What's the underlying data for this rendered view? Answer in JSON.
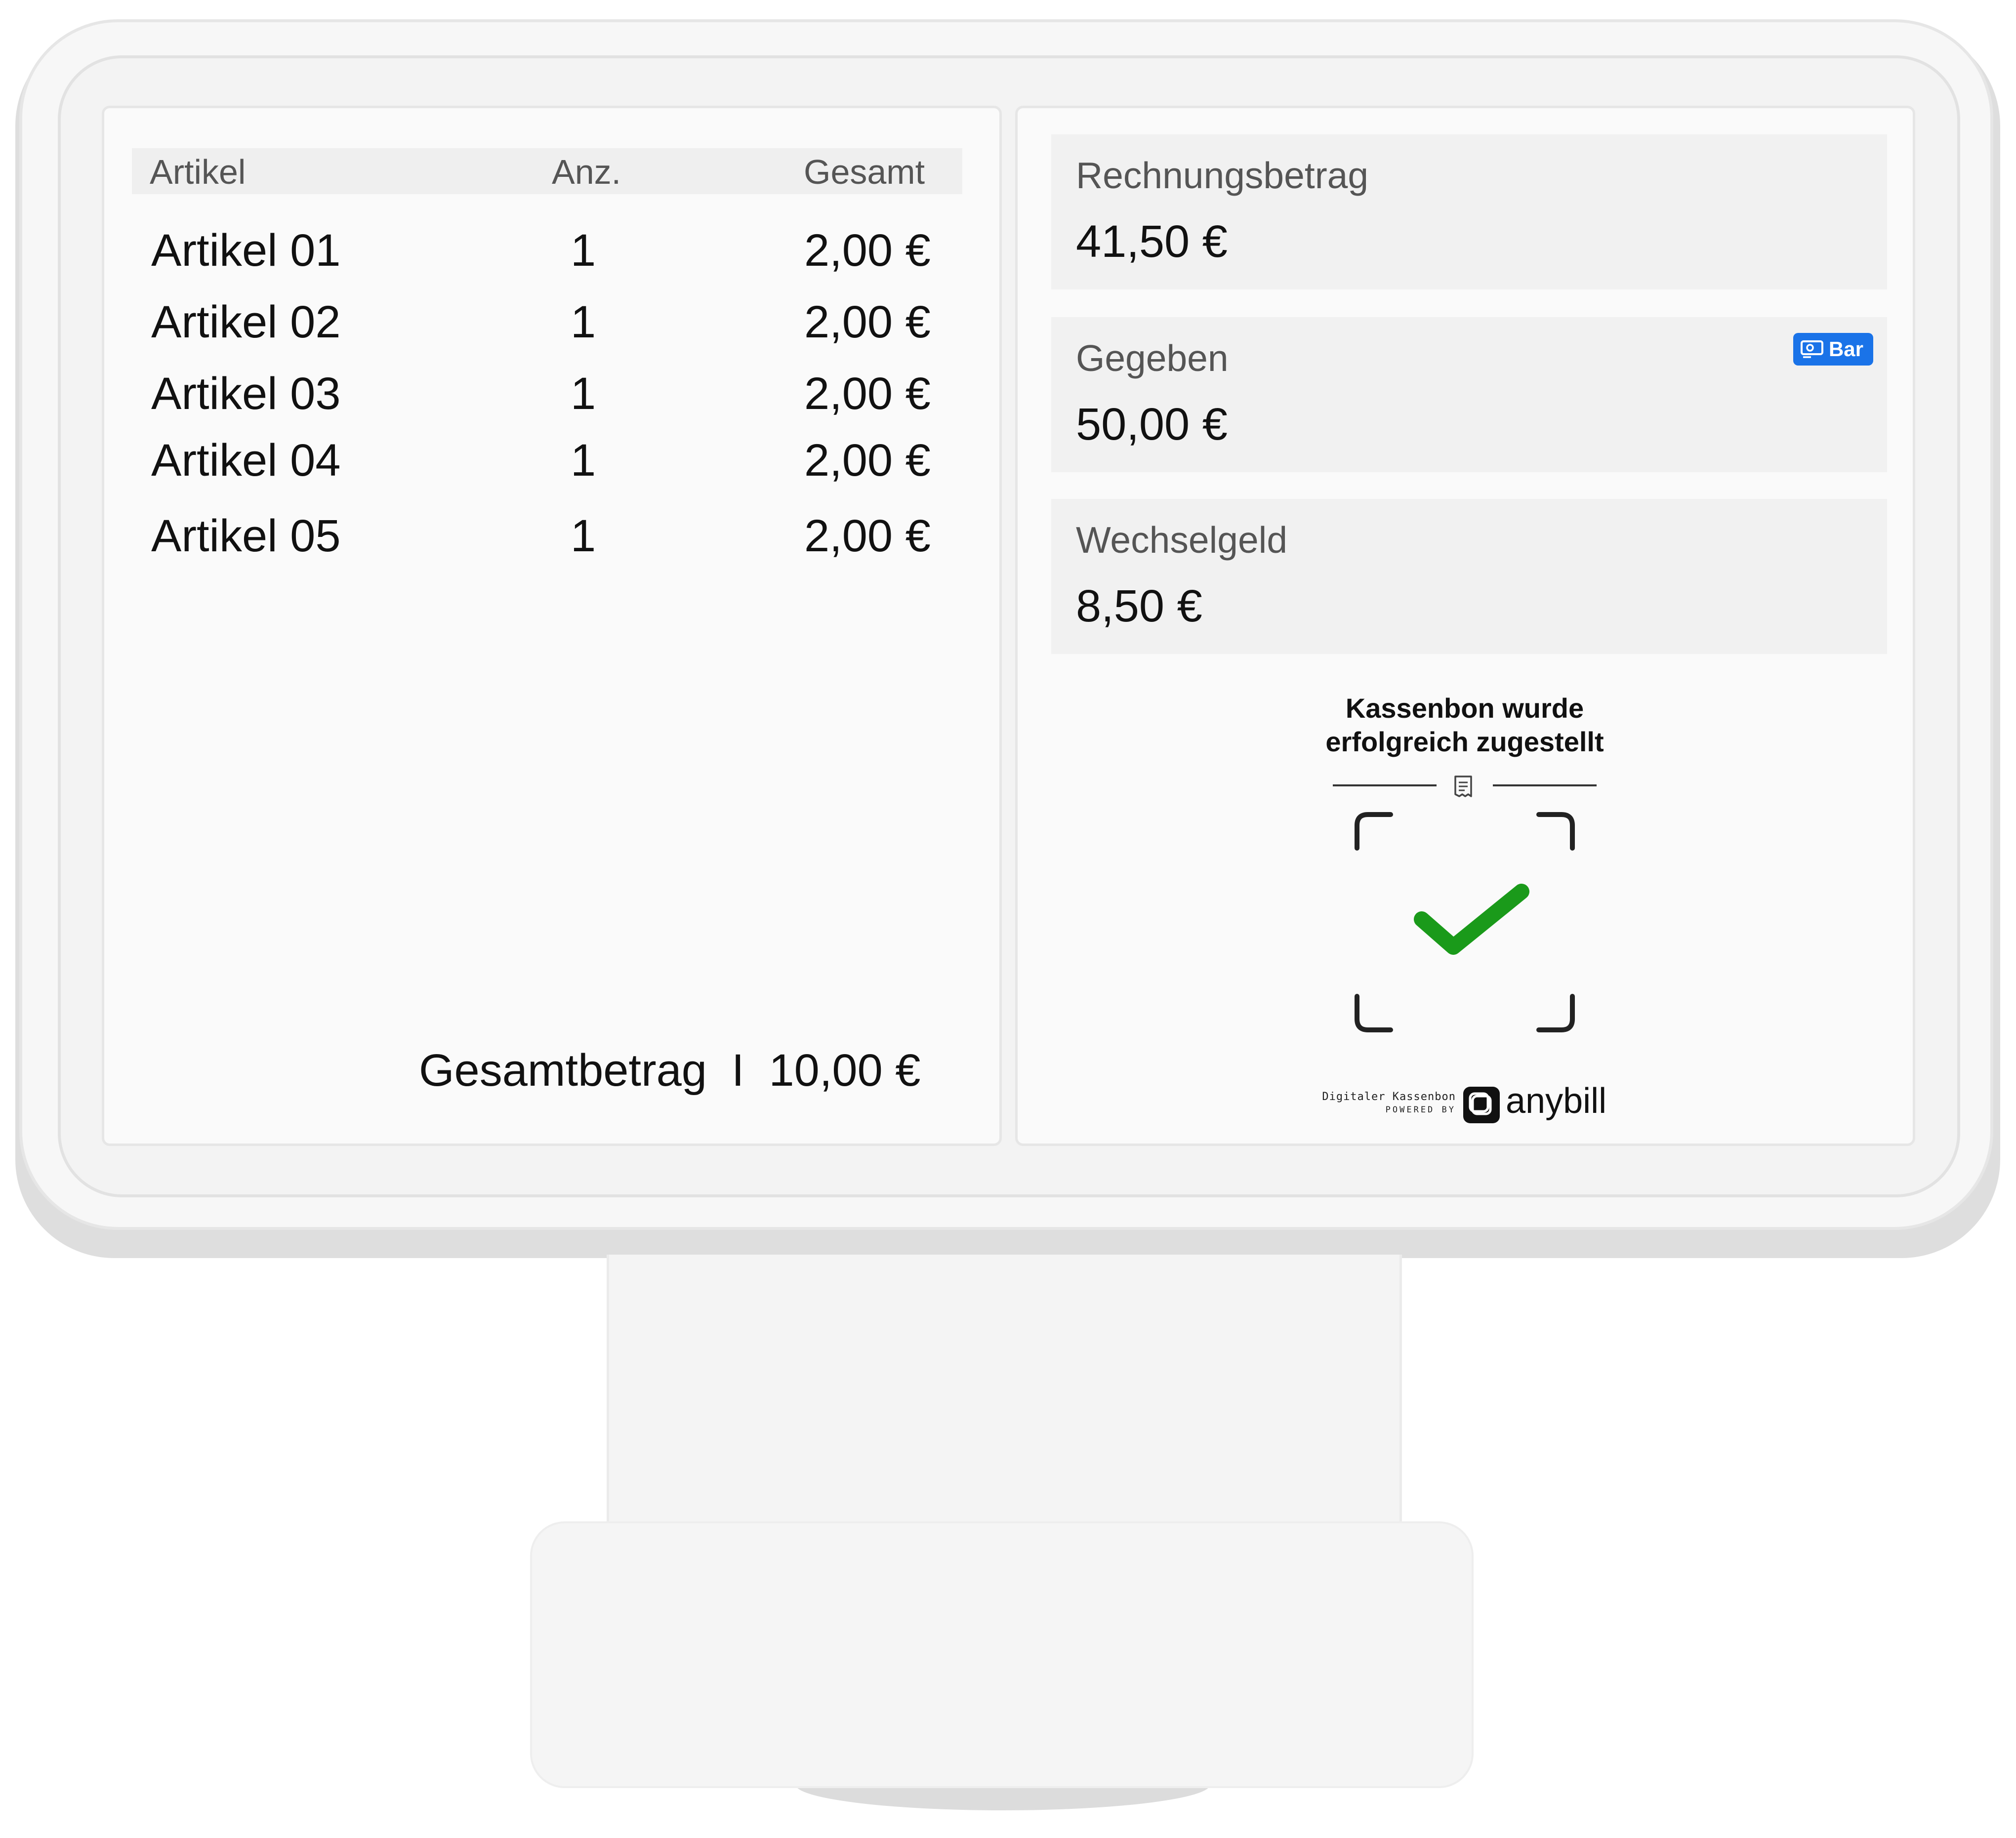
{
  "receipt": {
    "headers": {
      "item": "Artikel",
      "qty": "Anz.",
      "total": "Gesamt"
    },
    "items": [
      {
        "name": "Artikel 01",
        "qty": "1",
        "total": "2,00 €"
      },
      {
        "name": "Artikel 02",
        "qty": "1",
        "total": "2,00 €"
      },
      {
        "name": "Artikel 03",
        "qty": "1",
        "total": "2,00 €"
      },
      {
        "name": "Artikel 04",
        "qty": "1",
        "total": "2,00 €"
      },
      {
        "name": "Artikel 05",
        "qty": "1",
        "total": "2,00 €"
      }
    ],
    "total_label": "Gesamtbetrag",
    "total_separator": "I",
    "total_value": "10,00 €"
  },
  "payment": {
    "invoice": {
      "label": "Rechnungsbetrag",
      "value": "41,50 €"
    },
    "given": {
      "label": "Gegeben",
      "value": "50,00 €",
      "method_badge": "Bar"
    },
    "change": {
      "label": "Wechselgeld",
      "value": "8,50 €"
    }
  },
  "status": {
    "line1": "Kassenbon wurde",
    "line2": "erfolgreich zugestellt"
  },
  "footer": {
    "line1": "Digitaler Kassenbon",
    "line2": "POWERED BY",
    "brand": "anybill"
  },
  "colors": {
    "accent_blue": "#1a73e8",
    "success_green": "#1a9a1a",
    "panel_bg": "#fafafa",
    "card_bg": "#f1f1f1"
  },
  "icons": [
    "receipt-icon",
    "checkmark-icon",
    "cash-icon",
    "anybill-logo-icon"
  ]
}
